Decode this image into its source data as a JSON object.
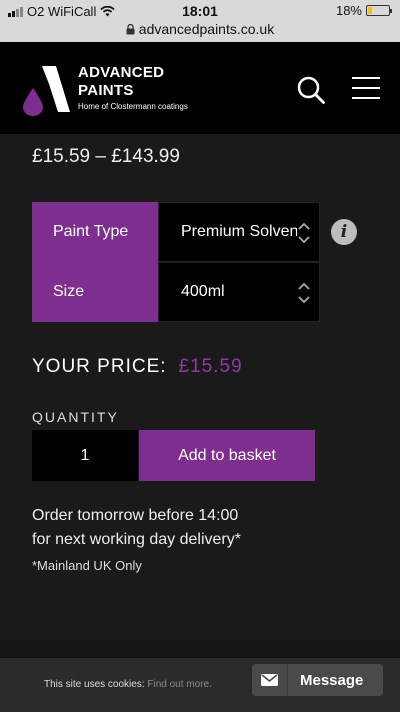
{
  "status_bar": {
    "carrier": "O2 WiFiCall",
    "time": "18:01",
    "battery": "18%",
    "battery_level": 0.18,
    "url": "advancedpaints.co.uk"
  },
  "header": {
    "brand_line1": "ADVANCED",
    "brand_line2": "PAINTS",
    "tagline": "Home of Clostermann coatings",
    "icons": [
      "search-icon",
      "menu-icon"
    ]
  },
  "product": {
    "price_range": "£15.59 – £143.99",
    "options": [
      {
        "label": "Paint Type",
        "value": "Premium Solvent"
      },
      {
        "label": "Size",
        "value": "400ml"
      }
    ],
    "your_price_label": "YOUR PRICE:",
    "your_price": "£15.59",
    "quantity_label": "QUANTITY",
    "quantity": "1",
    "add_to_basket": "Add to basket",
    "delivery_line1": "Order tomorrow before 14:00",
    "delivery_line2": "for next working day delivery*",
    "mainland_note": "*Mainland UK Only"
  },
  "cookie_bar": {
    "text": "This site uses cookies:",
    "link": "Find out more.",
    "message_button": "Message"
  },
  "colors": {
    "accent": "#7d2e8e",
    "price_accent": "#8e3aa0",
    "header_bg": "#000000",
    "page_bg": "#1a1a1a"
  }
}
